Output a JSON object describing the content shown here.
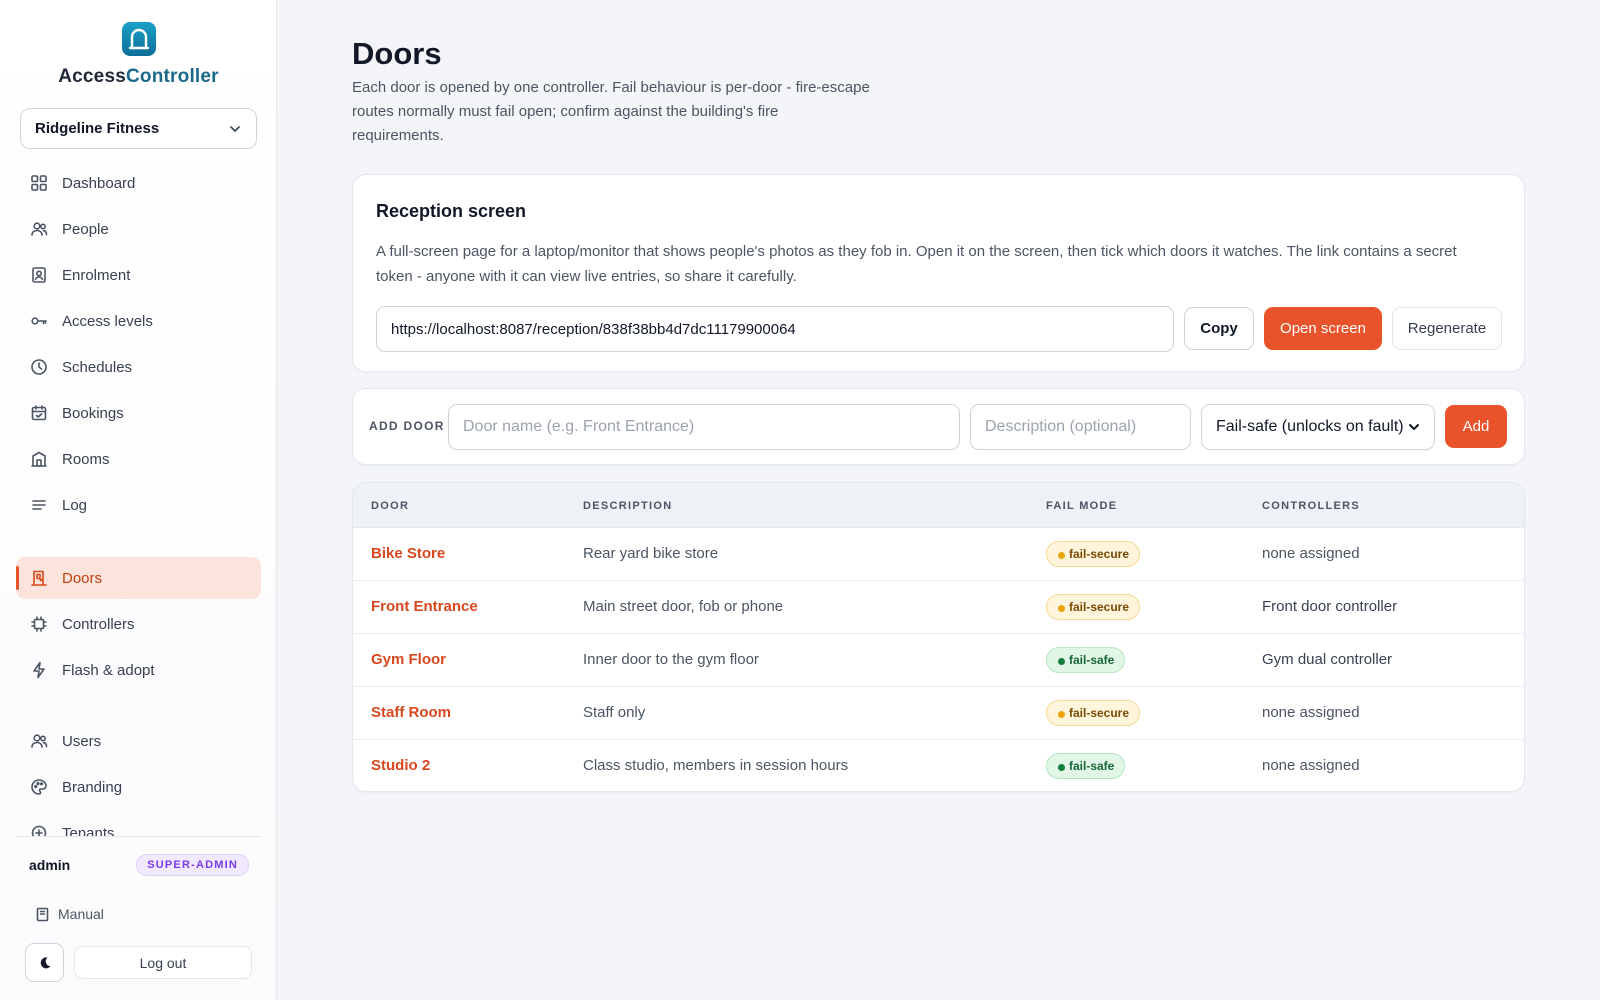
{
  "brand": {
    "name_part1": "Access",
    "name_part2": "Controller"
  },
  "tenant": {
    "selected": "Ridgeline Fitness"
  },
  "nav": {
    "items": [
      {
        "label": "Dashboard",
        "icon": "grid-icon"
      },
      {
        "label": "People",
        "icon": "people-icon"
      },
      {
        "label": "Enrolment",
        "icon": "id-badge-icon"
      },
      {
        "label": "Access levels",
        "icon": "key-icon"
      },
      {
        "label": "Schedules",
        "icon": "clock-icon"
      },
      {
        "label": "Bookings",
        "icon": "calendar-icon"
      },
      {
        "label": "Rooms",
        "icon": "room-icon"
      },
      {
        "label": "Log",
        "icon": "list-icon"
      },
      {
        "label": "Doors",
        "icon": "door-icon",
        "active": true
      },
      {
        "label": "Controllers",
        "icon": "chip-icon"
      },
      {
        "label": "Flash & adopt",
        "icon": "bolt-icon"
      },
      {
        "label": "Users",
        "icon": "users-icon"
      },
      {
        "label": "Branding",
        "icon": "palette-icon"
      },
      {
        "label": "Tenants",
        "icon": "building-icon"
      }
    ]
  },
  "user": {
    "name": "admin",
    "role": "SUPER-ADMIN"
  },
  "footer": {
    "manual": "Manual",
    "logout": "Log out"
  },
  "page": {
    "title": "Doors",
    "subtitle": "Each door is opened by one controller. Fail behaviour is per-door - fire-escape routes normally must fail open; confirm against the building's fire requirements."
  },
  "reception": {
    "title": "Reception screen",
    "description": "A full-screen page for a laptop/monitor that shows people's photos as they fob in. Open it on the screen, then tick which doors it watches. The link contains a secret token - anyone with it can view live entries, so share it carefully.",
    "url": "https://localhost:8087/reception/838f38bb4d7dc11179900064",
    "copy_label": "Copy",
    "open_label": "Open screen",
    "regenerate_label": "Regenerate"
  },
  "add_door": {
    "label": "ADD DOOR",
    "name_placeholder": "Door name (e.g. Front Entrance)",
    "desc_placeholder": "Description (optional)",
    "mode_selected": "Fail-safe (unlocks on fault)",
    "add_label": "Add"
  },
  "table": {
    "headers": {
      "door": "DOOR",
      "description": "DESCRIPTION",
      "fail_mode": "FAIL MODE",
      "controllers": "CONTROLLERS"
    },
    "rows": [
      {
        "door": "Bike Store",
        "description": "Rear yard bike store",
        "fail_mode": "fail-secure",
        "controllers": "none assigned"
      },
      {
        "door": "Front Entrance",
        "description": "Main street door, fob or phone",
        "fail_mode": "fail-secure",
        "controllers": "Front door controller"
      },
      {
        "door": "Gym Floor",
        "description": "Inner door to the gym floor",
        "fail_mode": "fail-safe",
        "controllers": "Gym dual controller"
      },
      {
        "door": "Staff Room",
        "description": "Staff only",
        "fail_mode": "fail-secure",
        "controllers": "none assigned"
      },
      {
        "door": "Studio 2",
        "description": "Class studio, members in session hours",
        "fail_mode": "fail-safe",
        "controllers": "none assigned"
      }
    ]
  },
  "colors": {
    "accent": "#e8532b",
    "brand": "#1b6a8c",
    "active_bg": "#fce4dd"
  }
}
